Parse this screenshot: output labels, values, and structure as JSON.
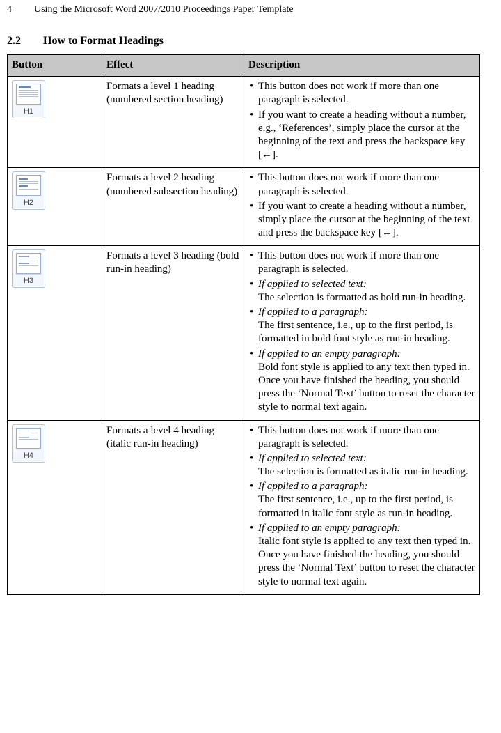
{
  "page_number": "4",
  "running_title": "Using the Microsoft Word 2007/2010 Proceedings Paper Template",
  "section": {
    "number": "2.2",
    "title": "How to Format Headings"
  },
  "headers": {
    "button": "Button",
    "effect": "Effect",
    "description": "Description"
  },
  "rows": [
    {
      "btn_label": "H1",
      "effect": "Formats a level 1 heading (numbered section heading)",
      "bullets": [
        {
          "text": "This button does not work if more than one paragraph is selected."
        },
        {
          "text": "If you want to create a heading without a number, e.g., ‘References’, simply place the cursor at the beginning of the text and press the backspace key [←]."
        }
      ]
    },
    {
      "btn_label": "H2",
      "effect": "Formats a level 2 heading (numbered subsection heading)",
      "bullets": [
        {
          "text": "This button does not work if more than one paragraph is selected."
        },
        {
          "text": "If you want to create a heading without a number, simply place the cursor at the beginning of the text and press the backspace key [←]."
        }
      ]
    },
    {
      "btn_label": "H3",
      "effect": "Formats a level 3 heading (bold run-in heading)",
      "bullets": [
        {
          "text": "This button does not work if more than one paragraph is selected."
        },
        {
          "lead_italic": "If applied to selected text:",
          "text": "The selection is formatted as bold run-in heading."
        },
        {
          "lead_italic": "If applied to a paragraph:",
          "text": "The first sentence, i.e., up to the first period, is formatted in bold font style as run-in heading."
        },
        {
          "lead_italic": "If applied to an empty paragraph:",
          "text": "Bold font style is applied to any text then typed in. Once you have finished the heading, you should press the ‘Normal Text’ button to reset the character style to normal text again."
        }
      ]
    },
    {
      "btn_label": "H4",
      "effect": "Formats a level 4 heading (italic run-in heading)",
      "bullets": [
        {
          "text": "This button does not work if more than one paragraph is selected."
        },
        {
          "lead_italic": "If applied to selected text:",
          "text": "The selection is formatted as italic run-in heading."
        },
        {
          "lead_italic": "If applied to a paragraph:",
          "text": "The first sentence, i.e., up to the first period, is formatted in italic font style as run-in heading."
        },
        {
          "lead_italic": "If applied to an empty paragraph:",
          "text": "Italic font style is applied to any text then typed in. Once you have finished the heading, you should press the ‘Normal Text’ button to reset the character style to normal text again."
        }
      ]
    }
  ]
}
